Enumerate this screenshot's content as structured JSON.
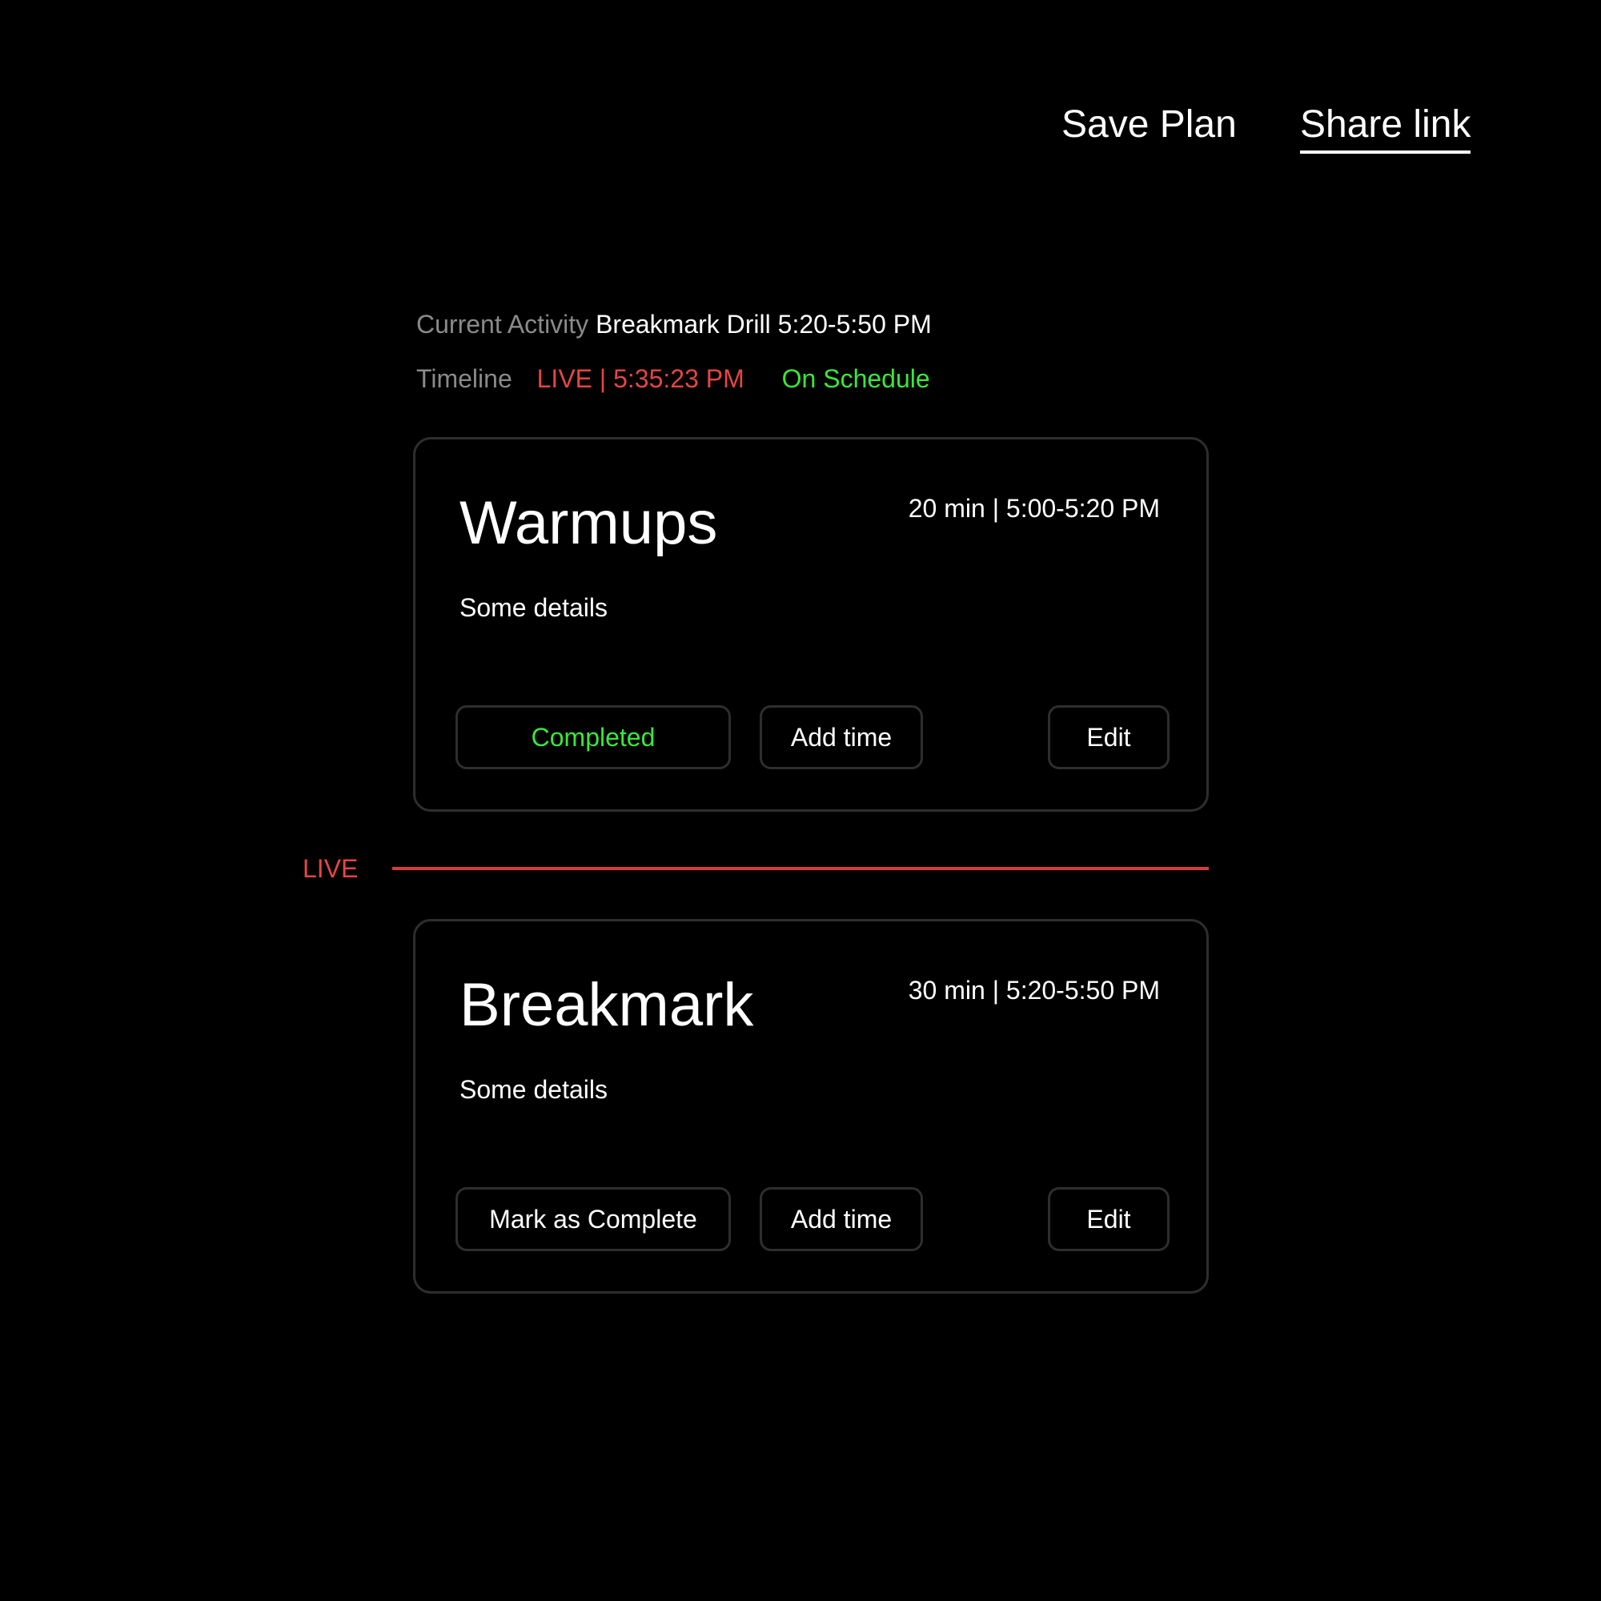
{
  "header": {
    "save_label": "Save Plan",
    "share_label": "Share link"
  },
  "status": {
    "current_label": "Current Activity",
    "current_value": "Breakmark Drill 5:20-5:50 PM",
    "timeline_label": "Timeline",
    "live_time": "LIVE | 5:35:23 PM",
    "schedule_status": "On Schedule"
  },
  "live_marker": {
    "label": "LIVE"
  },
  "activities": [
    {
      "title": "Warmups",
      "time": "20 min | 5:00-5:20 PM",
      "details": "Some details",
      "primary_action": "Completed",
      "add_time_label": "Add time",
      "edit_label": "Edit"
    },
    {
      "title": "Breakmark",
      "time": "30 min | 5:20-5:50 PM",
      "details": "Some details",
      "primary_action": "Mark as Complete",
      "add_time_label": "Add time",
      "edit_label": "Edit"
    }
  ],
  "colors": {
    "background": "#000000",
    "live_red": "#e64545",
    "success_green": "#39e839",
    "muted_gray": "#8a8a8a",
    "border": "#2e2e2e"
  }
}
